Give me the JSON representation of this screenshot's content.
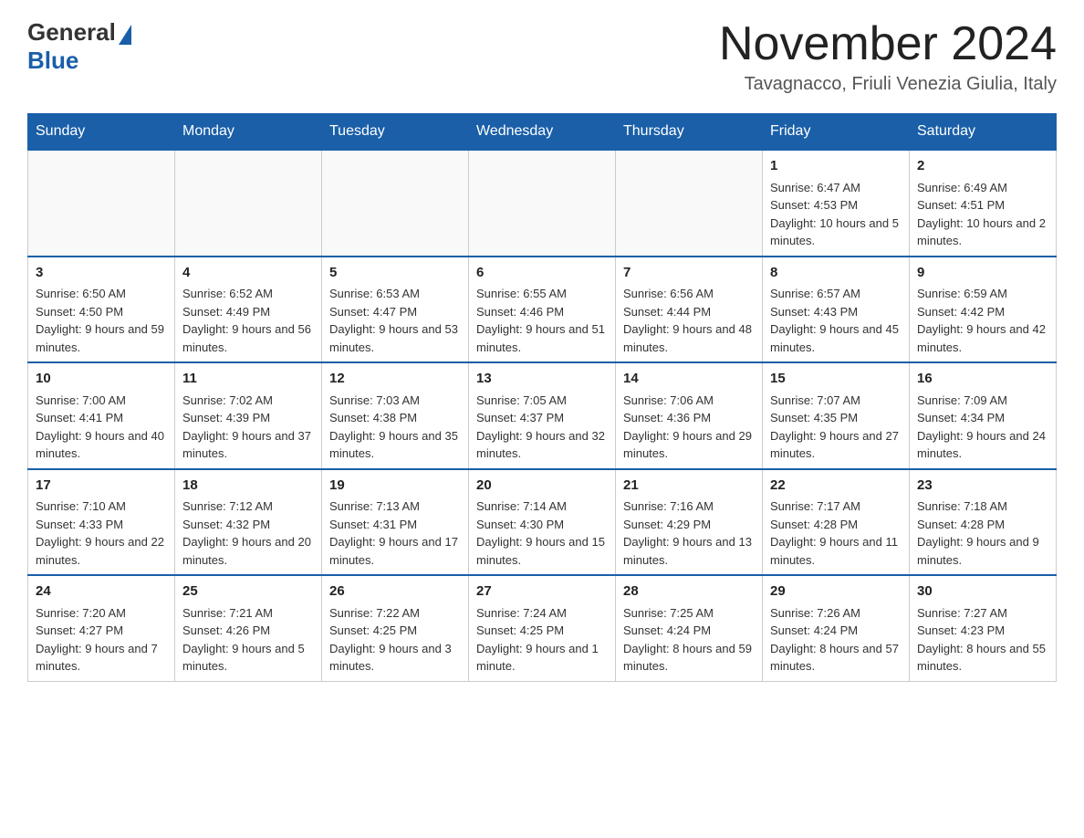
{
  "header": {
    "logo_general": "General",
    "logo_blue": "Blue",
    "month_title": "November 2024",
    "location": "Tavagnacco, Friuli Venezia Giulia, Italy"
  },
  "days_of_week": [
    "Sunday",
    "Monday",
    "Tuesday",
    "Wednesday",
    "Thursday",
    "Friday",
    "Saturday"
  ],
  "weeks": [
    [
      {
        "day": "",
        "sunrise": "",
        "sunset": "",
        "daylight": ""
      },
      {
        "day": "",
        "sunrise": "",
        "sunset": "",
        "daylight": ""
      },
      {
        "day": "",
        "sunrise": "",
        "sunset": "",
        "daylight": ""
      },
      {
        "day": "",
        "sunrise": "",
        "sunset": "",
        "daylight": ""
      },
      {
        "day": "",
        "sunrise": "",
        "sunset": "",
        "daylight": ""
      },
      {
        "day": "1",
        "sunrise": "Sunrise: 6:47 AM",
        "sunset": "Sunset: 4:53 PM",
        "daylight": "Daylight: 10 hours and 5 minutes."
      },
      {
        "day": "2",
        "sunrise": "Sunrise: 6:49 AM",
        "sunset": "Sunset: 4:51 PM",
        "daylight": "Daylight: 10 hours and 2 minutes."
      }
    ],
    [
      {
        "day": "3",
        "sunrise": "Sunrise: 6:50 AM",
        "sunset": "Sunset: 4:50 PM",
        "daylight": "Daylight: 9 hours and 59 minutes."
      },
      {
        "day": "4",
        "sunrise": "Sunrise: 6:52 AM",
        "sunset": "Sunset: 4:49 PM",
        "daylight": "Daylight: 9 hours and 56 minutes."
      },
      {
        "day": "5",
        "sunrise": "Sunrise: 6:53 AM",
        "sunset": "Sunset: 4:47 PM",
        "daylight": "Daylight: 9 hours and 53 minutes."
      },
      {
        "day": "6",
        "sunrise": "Sunrise: 6:55 AM",
        "sunset": "Sunset: 4:46 PM",
        "daylight": "Daylight: 9 hours and 51 minutes."
      },
      {
        "day": "7",
        "sunrise": "Sunrise: 6:56 AM",
        "sunset": "Sunset: 4:44 PM",
        "daylight": "Daylight: 9 hours and 48 minutes."
      },
      {
        "day": "8",
        "sunrise": "Sunrise: 6:57 AM",
        "sunset": "Sunset: 4:43 PM",
        "daylight": "Daylight: 9 hours and 45 minutes."
      },
      {
        "day": "9",
        "sunrise": "Sunrise: 6:59 AM",
        "sunset": "Sunset: 4:42 PM",
        "daylight": "Daylight: 9 hours and 42 minutes."
      }
    ],
    [
      {
        "day": "10",
        "sunrise": "Sunrise: 7:00 AM",
        "sunset": "Sunset: 4:41 PM",
        "daylight": "Daylight: 9 hours and 40 minutes."
      },
      {
        "day": "11",
        "sunrise": "Sunrise: 7:02 AM",
        "sunset": "Sunset: 4:39 PM",
        "daylight": "Daylight: 9 hours and 37 minutes."
      },
      {
        "day": "12",
        "sunrise": "Sunrise: 7:03 AM",
        "sunset": "Sunset: 4:38 PM",
        "daylight": "Daylight: 9 hours and 35 minutes."
      },
      {
        "day": "13",
        "sunrise": "Sunrise: 7:05 AM",
        "sunset": "Sunset: 4:37 PM",
        "daylight": "Daylight: 9 hours and 32 minutes."
      },
      {
        "day": "14",
        "sunrise": "Sunrise: 7:06 AM",
        "sunset": "Sunset: 4:36 PM",
        "daylight": "Daylight: 9 hours and 29 minutes."
      },
      {
        "day": "15",
        "sunrise": "Sunrise: 7:07 AM",
        "sunset": "Sunset: 4:35 PM",
        "daylight": "Daylight: 9 hours and 27 minutes."
      },
      {
        "day": "16",
        "sunrise": "Sunrise: 7:09 AM",
        "sunset": "Sunset: 4:34 PM",
        "daylight": "Daylight: 9 hours and 24 minutes."
      }
    ],
    [
      {
        "day": "17",
        "sunrise": "Sunrise: 7:10 AM",
        "sunset": "Sunset: 4:33 PM",
        "daylight": "Daylight: 9 hours and 22 minutes."
      },
      {
        "day": "18",
        "sunrise": "Sunrise: 7:12 AM",
        "sunset": "Sunset: 4:32 PM",
        "daylight": "Daylight: 9 hours and 20 minutes."
      },
      {
        "day": "19",
        "sunrise": "Sunrise: 7:13 AM",
        "sunset": "Sunset: 4:31 PM",
        "daylight": "Daylight: 9 hours and 17 minutes."
      },
      {
        "day": "20",
        "sunrise": "Sunrise: 7:14 AM",
        "sunset": "Sunset: 4:30 PM",
        "daylight": "Daylight: 9 hours and 15 minutes."
      },
      {
        "day": "21",
        "sunrise": "Sunrise: 7:16 AM",
        "sunset": "Sunset: 4:29 PM",
        "daylight": "Daylight: 9 hours and 13 minutes."
      },
      {
        "day": "22",
        "sunrise": "Sunrise: 7:17 AM",
        "sunset": "Sunset: 4:28 PM",
        "daylight": "Daylight: 9 hours and 11 minutes."
      },
      {
        "day": "23",
        "sunrise": "Sunrise: 7:18 AM",
        "sunset": "Sunset: 4:28 PM",
        "daylight": "Daylight: 9 hours and 9 minutes."
      }
    ],
    [
      {
        "day": "24",
        "sunrise": "Sunrise: 7:20 AM",
        "sunset": "Sunset: 4:27 PM",
        "daylight": "Daylight: 9 hours and 7 minutes."
      },
      {
        "day": "25",
        "sunrise": "Sunrise: 7:21 AM",
        "sunset": "Sunset: 4:26 PM",
        "daylight": "Daylight: 9 hours and 5 minutes."
      },
      {
        "day": "26",
        "sunrise": "Sunrise: 7:22 AM",
        "sunset": "Sunset: 4:25 PM",
        "daylight": "Daylight: 9 hours and 3 minutes."
      },
      {
        "day": "27",
        "sunrise": "Sunrise: 7:24 AM",
        "sunset": "Sunset: 4:25 PM",
        "daylight": "Daylight: 9 hours and 1 minute."
      },
      {
        "day": "28",
        "sunrise": "Sunrise: 7:25 AM",
        "sunset": "Sunset: 4:24 PM",
        "daylight": "Daylight: 8 hours and 59 minutes."
      },
      {
        "day": "29",
        "sunrise": "Sunrise: 7:26 AM",
        "sunset": "Sunset: 4:24 PM",
        "daylight": "Daylight: 8 hours and 57 minutes."
      },
      {
        "day": "30",
        "sunrise": "Sunrise: 7:27 AM",
        "sunset": "Sunset: 4:23 PM",
        "daylight": "Daylight: 8 hours and 55 minutes."
      }
    ]
  ]
}
